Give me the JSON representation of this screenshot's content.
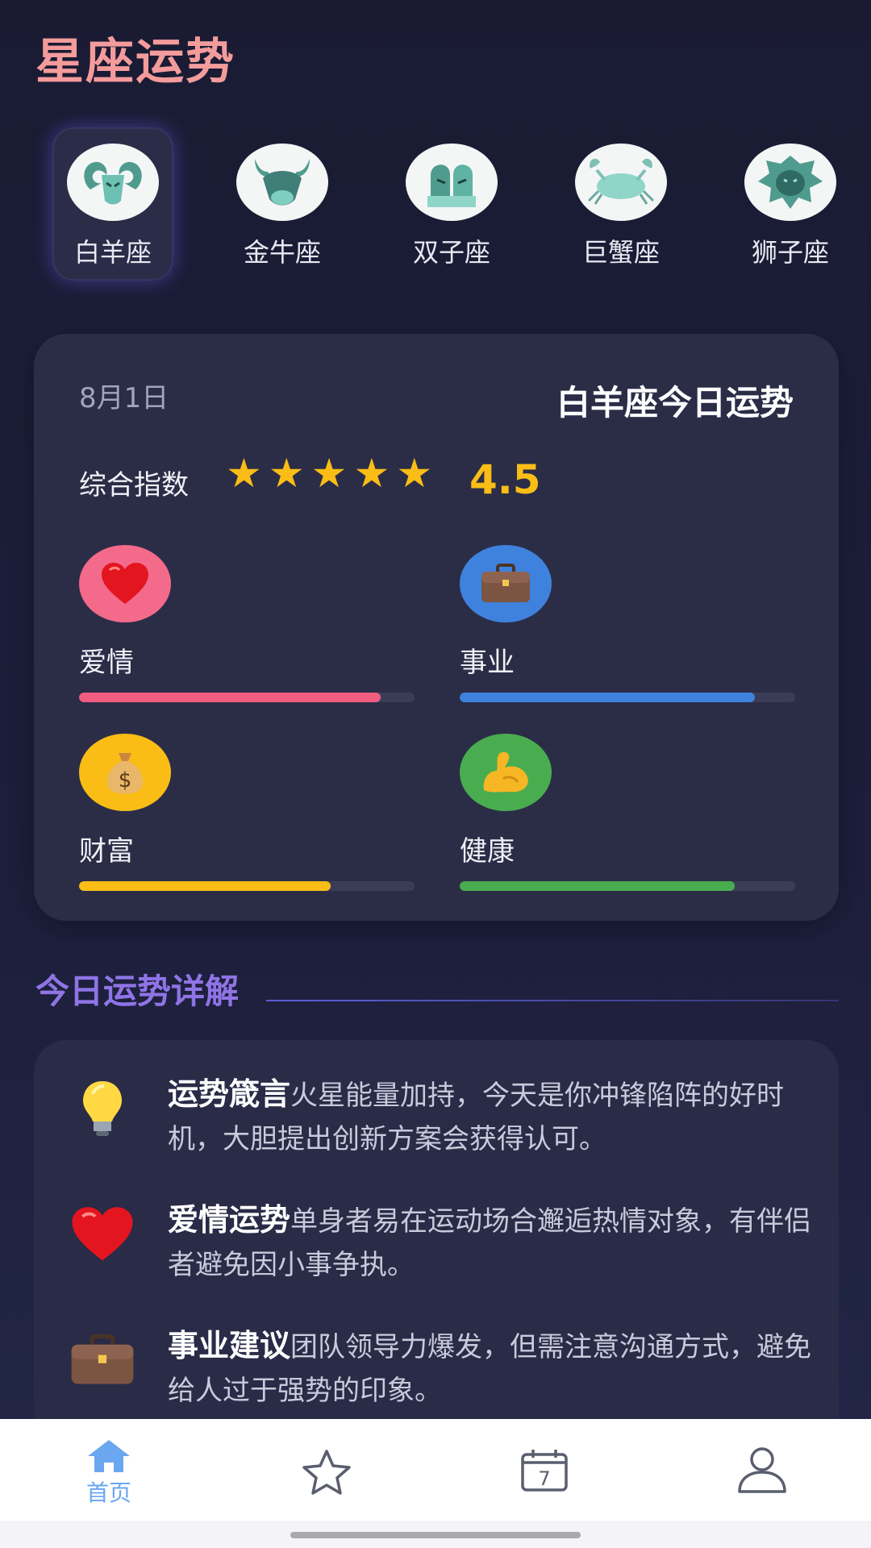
{
  "app": {
    "title": "星座运势"
  },
  "zodiac": [
    {
      "label": "白羊座",
      "icon": "aries-icon",
      "active": true
    },
    {
      "label": "金牛座",
      "icon": "taurus-icon",
      "active": false
    },
    {
      "label": "双子座",
      "icon": "gemini-icon",
      "active": false
    },
    {
      "label": "巨蟹座",
      "icon": "cancer-icon",
      "active": false
    },
    {
      "label": "狮子座",
      "icon": "leo-icon",
      "active": false
    }
  ],
  "fortune": {
    "date": "8月1日",
    "title": "白羊座今日运势",
    "score_label": "综合指数",
    "stars": 5,
    "score": "4.5",
    "metrics": [
      {
        "label": "爱情",
        "icon": "heart-icon",
        "color": "#f05d80",
        "value": 0.9
      },
      {
        "label": "事业",
        "icon": "briefcase-icon",
        "color": "#3f82de",
        "value": 0.88
      },
      {
        "label": "财富",
        "icon": "money-bag-icon",
        "color": "#f9bd16",
        "value": 0.75
      },
      {
        "label": "健康",
        "icon": "muscle-icon",
        "color": "#49ad4f",
        "value": 0.82
      }
    ]
  },
  "details": {
    "section_title": "今日运势详解",
    "items": [
      {
        "icon": "lightbulb-icon",
        "title": "运势箴言",
        "text": "火星能量加持，今天是你冲锋陷阵的好时机，大胆提出创新方案会获得认可。"
      },
      {
        "icon": "heart-icon",
        "title": "爱情运势",
        "text": "单身者易在运动场合邂逅热情对象，有伴侣者避免因小事争执。"
      },
      {
        "icon": "briefcase-icon",
        "title": "事业建议",
        "text": "团队领导力爆发，但需注意沟通方式，避免给人过于强势的印象。"
      }
    ]
  },
  "nav": [
    {
      "label": "首页",
      "icon": "home-icon",
      "active": true
    },
    {
      "label": "",
      "icon": "star-icon",
      "active": false
    },
    {
      "label": "7",
      "icon": "calendar-icon",
      "active": false
    },
    {
      "label": "",
      "icon": "user-icon",
      "active": false
    }
  ],
  "colors": {
    "accent": "#f49b9b",
    "star": "#f9bd16",
    "section": "#8f74e6",
    "nav_active": "#6aa7f0"
  }
}
